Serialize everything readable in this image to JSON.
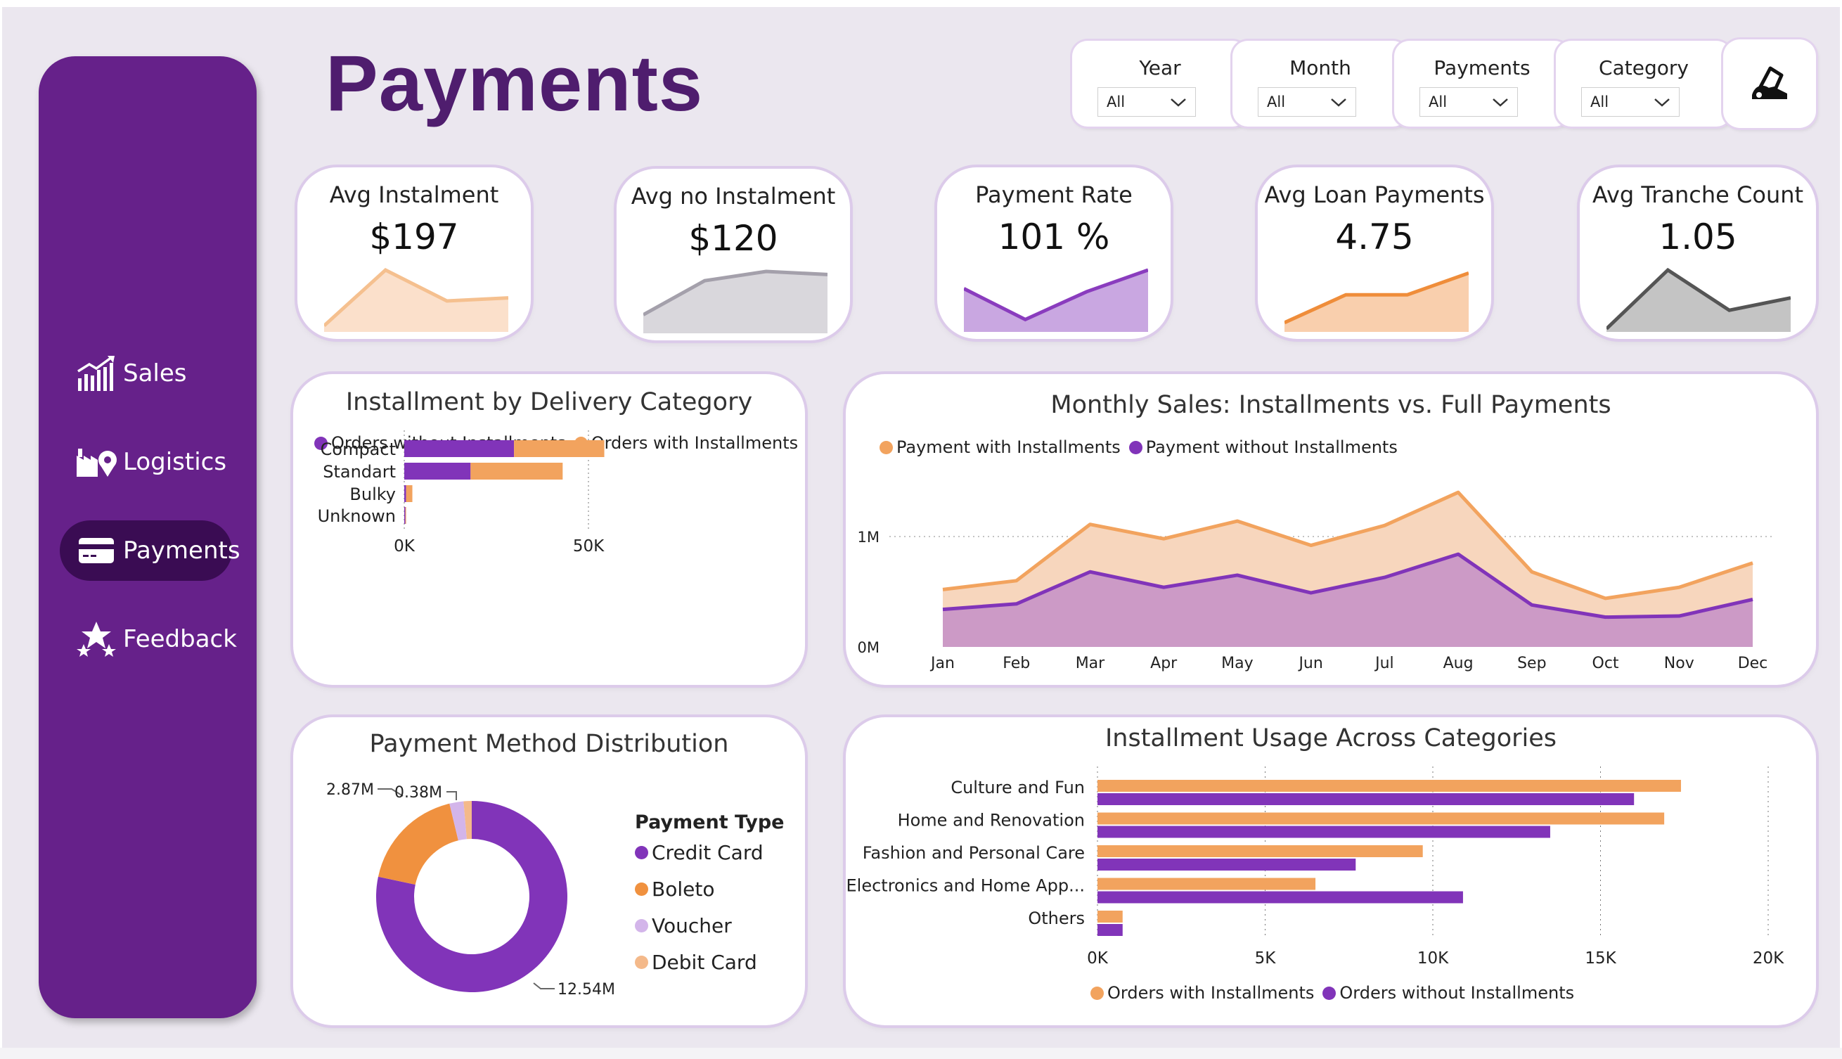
{
  "page_title": "Payments",
  "colors": {
    "purple": "#8134b9",
    "orange": "#f2a35e",
    "sidebar": "#66218a",
    "title": "#4f1d6e"
  },
  "sidebar": {
    "items": [
      {
        "label": "Sales",
        "icon": "sales-chart-icon"
      },
      {
        "label": "Logistics",
        "icon": "factory-location-icon"
      },
      {
        "label": "Payments",
        "icon": "credit-card-icon",
        "active": true
      },
      {
        "label": "Feedback",
        "icon": "stars-feedback-icon"
      }
    ]
  },
  "filters": [
    {
      "label": "Year",
      "value": "All"
    },
    {
      "label": "Month",
      "value": "All"
    },
    {
      "label": "Payments",
      "value": "All"
    },
    {
      "label": "Category",
      "value": "All"
    }
  ],
  "kpis": [
    {
      "title": "Avg Instalment",
      "value": "$197",
      "trend": [
        0.1,
        1.0,
        0.5,
        0.55
      ],
      "stroke": "#f5c08f",
      "fill": "#fbe0cb"
    },
    {
      "title": "Avg no Instalment",
      "value": "$120",
      "trend": [
        0.3,
        0.85,
        1.0,
        0.95
      ],
      "stroke": "#a4a0ab",
      "fill": "#d9d7dc"
    },
    {
      "title": "Payment Rate",
      "value": "101 %",
      "trend": [
        0.7,
        0.2,
        0.65,
        1.0
      ],
      "stroke": "#8a3cbe",
      "fill": "#c9a7e1"
    },
    {
      "title": "Avg Loan Payments",
      "value": "4.75",
      "trend": [
        0.15,
        0.6,
        0.6,
        0.95
      ],
      "stroke": "#ef8d3a",
      "fill": "#f9cfad"
    },
    {
      "title": "Avg Tranche Count",
      "value": "1.05",
      "trend": [
        0.05,
        1.0,
        0.35,
        0.55
      ],
      "stroke": "#555555",
      "fill": "#c4c4c4"
    }
  ],
  "delivery_chart": {
    "title": "Installment by Delivery Category",
    "legend": [
      "Orders without Installments",
      "Orders with Installments"
    ],
    "x_ticks": [
      "0K",
      "50K"
    ],
    "chart_data": {
      "type": "bar",
      "stacked": true,
      "orientation": "horizontal",
      "categories": [
        "Compact",
        "Standart",
        "Bulky",
        "Unknown"
      ],
      "series": [
        {
          "name": "Orders without Installments",
          "values": [
            29800,
            18000,
            500,
            300
          ]
        },
        {
          "name": "Orders with Installments",
          "values": [
            24500,
            25000,
            1700,
            200
          ]
        }
      ],
      "xlim": [
        0,
        60000
      ]
    }
  },
  "monthly_chart": {
    "title": "Monthly Sales: Installments vs. Full Payments",
    "legend": [
      "Payment with Installments",
      "Payment without Installments"
    ],
    "y_ticks": [
      "1M",
      "0M"
    ],
    "chart_data": {
      "type": "area",
      "categories": [
        "Jan",
        "Feb",
        "Mar",
        "Apr",
        "May",
        "Jun",
        "Jul",
        "Aug",
        "Sep",
        "Oct",
        "Nov",
        "Dec"
      ],
      "series": [
        {
          "name": "Payment with Installments",
          "values": [
            0.52,
            0.6,
            1.11,
            0.98,
            1.14,
            0.92,
            1.1,
            1.4,
            0.68,
            0.44,
            0.54,
            0.76
          ]
        },
        {
          "name": "Payment without Installments",
          "values": [
            0.34,
            0.39,
            0.68,
            0.54,
            0.65,
            0.49,
            0.63,
            0.84,
            0.38,
            0.27,
            0.28,
            0.43
          ]
        }
      ],
      "ylim": [
        0,
        1.5
      ],
      "ylabel": "",
      "grid": true
    }
  },
  "donut_chart": {
    "title": "Payment Method Distribution",
    "legend_title": "Payment Type",
    "chart_data": {
      "type": "pie",
      "donut": true,
      "labels": [
        "Credit Card",
        "Boleto",
        "Voucher",
        "Debit Card"
      ],
      "values": [
        12.54,
        2.87,
        0.38,
        0.22
      ],
      "value_labels": [
        "12.54M",
        "2.87M",
        "0.38M",
        ""
      ],
      "colors": [
        "#8134b9",
        "#f0913f",
        "#d3b5ea",
        "#f4b98a"
      ]
    }
  },
  "usage_chart": {
    "title": "Installment Usage Across Categories",
    "legend": [
      "Orders with Installments",
      "Orders without Installments"
    ],
    "x_ticks": [
      "0K",
      "5K",
      "10K",
      "15K",
      "20K"
    ],
    "chart_data": {
      "type": "bar",
      "orientation": "horizontal",
      "categories": [
        "Culture and Fun",
        "Home and Renovation",
        "Fashion and Personal Care",
        "Electronics and Home App...",
        "Others"
      ],
      "series": [
        {
          "name": "Orders with Installments",
          "values": [
            17400,
            16900,
            9700,
            6500,
            750
          ]
        },
        {
          "name": "Orders without Installments",
          "values": [
            16000,
            13500,
            7700,
            10900,
            750
          ]
        }
      ],
      "xlim": [
        0,
        20000
      ],
      "grid": true
    }
  }
}
